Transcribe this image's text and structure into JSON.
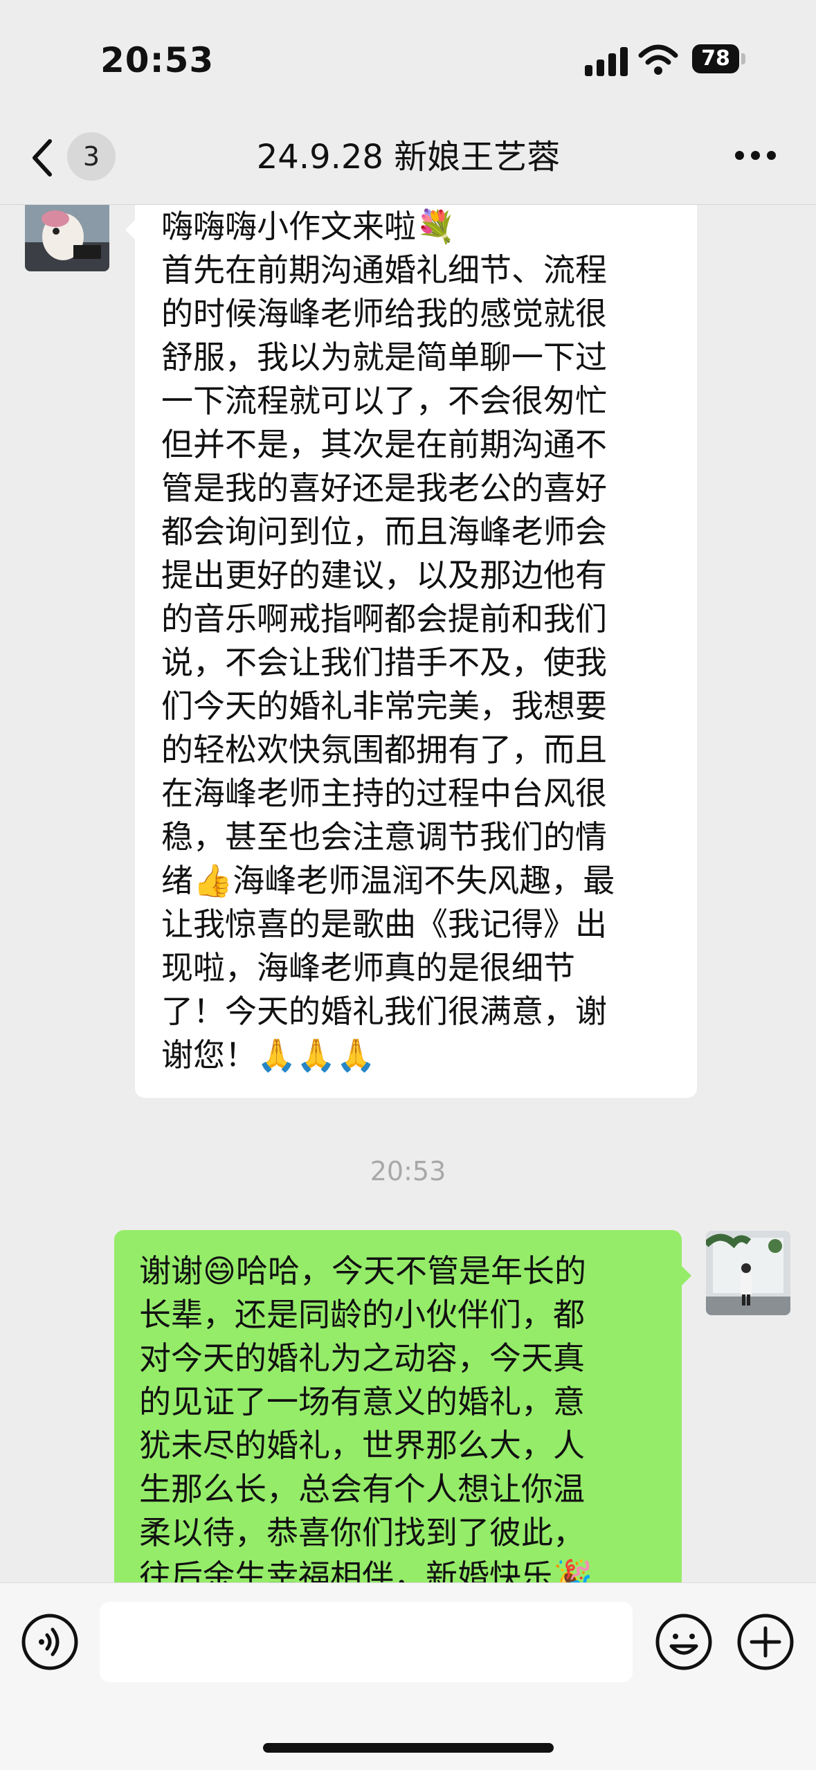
{
  "status_bar": {
    "time": "20:53",
    "battery": "78",
    "icons": [
      "signal-icon",
      "wifi-icon",
      "battery-icon"
    ]
  },
  "nav": {
    "unread_count": "3",
    "title": "24.9.28 新娘王艺蓉",
    "icons": [
      "back-icon",
      "more-icon"
    ]
  },
  "messages": {
    "incoming": {
      "lines": [
        "嗨嗨嗨小作文来啦💐",
        "首先在前期沟通婚礼细节、流程",
        "的时候海峰老师给我的感觉就很",
        "舒服，我以为就是简单聊一下过",
        "一下流程就可以了，不会很匆忙",
        "但并不是，其次是在前期沟通不",
        "管是我的喜好还是我老公的喜好",
        "都会询问到位，而且海峰老师会",
        "提出更好的建议，以及那边他有",
        "的音乐啊戒指啊都会提前和我们",
        "说，不会让我们措手不及，使我",
        "们今天的婚礼非常完美，我想要",
        "的轻松欢快氛围都拥有了，而且",
        "在海峰老师主持的过程中台风很",
        "稳，甚至也会注意调节我们的情",
        "绪👍海峰老师温润不失风趣，最",
        "让我惊喜的是歌曲《我记得》出",
        "现啦，海峰老师真的是很细节",
        "了！今天的婚礼我们很满意，谢",
        "谢您！🙏🙏🙏"
      ]
    },
    "timestamp": "20:53",
    "outgoing": {
      "lines": [
        "谢谢😄哈哈，今天不管是年长的",
        "长辈，还是同龄的小伙伴们，都",
        "对今天的婚礼为之动容，今天真",
        "的见证了一场有意义的婚礼，意",
        "犹未尽的婚礼，世界那么大，人",
        "生那么长，总会有个人想让你温",
        "柔以待，恭喜你们找到了彼此，",
        "往后余生幸福相伴，新婚快乐🎉"
      ]
    }
  },
  "input_bar": {
    "placeholder": "",
    "icons": [
      "voice-icon",
      "emoji-icon",
      "plus-icon"
    ]
  },
  "colors": {
    "background": "#ededed",
    "outgoing_bubble": "#95ec69",
    "incoming_bubble": "#ffffff",
    "timestamp": "#a8a8a8"
  }
}
